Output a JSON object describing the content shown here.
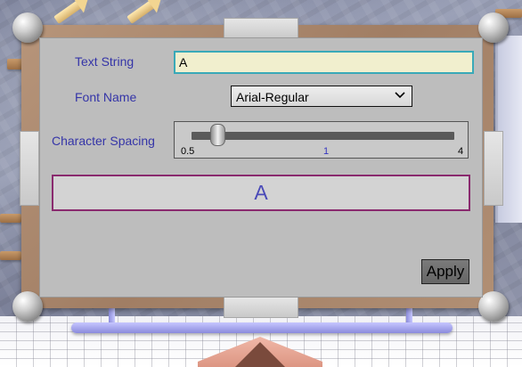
{
  "panel": {
    "text_string": {
      "label": "Text String",
      "value": "A"
    },
    "font_name": {
      "label": "Font Name",
      "selected": "Arial-Regular"
    },
    "character_spacing": {
      "label": "Character Spacing",
      "min_label": "0.5",
      "mid_label": "1",
      "max_label": "4",
      "value": 0.75,
      "min": 0.5,
      "max": 4
    },
    "preview_text": "A",
    "apply_label": "Apply"
  },
  "icons": {
    "dropdown": "chevron-down-icon"
  }
}
